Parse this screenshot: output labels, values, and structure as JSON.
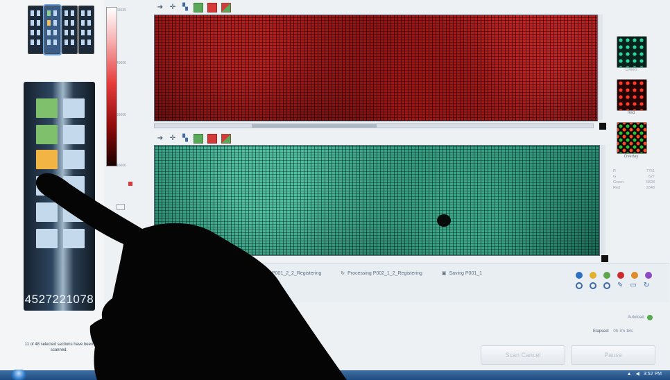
{
  "left_panel": {
    "slide_id": "4527221078",
    "status_message": "11 of 48 selected sections have been scanned."
  },
  "color_scale": {
    "tick_labels": [
      "65535",
      "49000",
      "33000",
      "16000"
    ]
  },
  "channels": [
    {
      "label": "Green"
    },
    {
      "label": "Red"
    },
    {
      "label": "Overlay"
    }
  ],
  "stats": {
    "rows": [
      {
        "k": "R",
        "v": "7751"
      },
      {
        "k": "G",
        "v": "627"
      },
      {
        "k": "Green",
        "v": "6828"
      },
      {
        "k": "Red",
        "v": "3348"
      }
    ]
  },
  "processing": {
    "item1": "P001_2_2_Registering",
    "item2": "Processing P002_1_2_Registering",
    "item3": "Saving P001_1"
  },
  "bottom": {
    "auto_load": "Autoload",
    "elapsed_label": "Elapsed:",
    "elapsed_value": "0h 7m 18s",
    "cancel_label": "Scan Cancel",
    "pause_label": "Pause"
  },
  "taskbar": {
    "time": "3:52 PM"
  },
  "colors": {
    "accent_blue": "#3f6aa0",
    "red_channel": "#b91e1e",
    "green_channel": "#2a8f76"
  },
  "legend_dots": [
    {
      "color": "#2f6fc2"
    },
    {
      "color": "#e0b12c"
    },
    {
      "color": "#5ea64a"
    },
    {
      "color": "#cc2b2b"
    },
    {
      "color": "#e08a2a"
    },
    {
      "color": "#8c49c4"
    }
  ]
}
